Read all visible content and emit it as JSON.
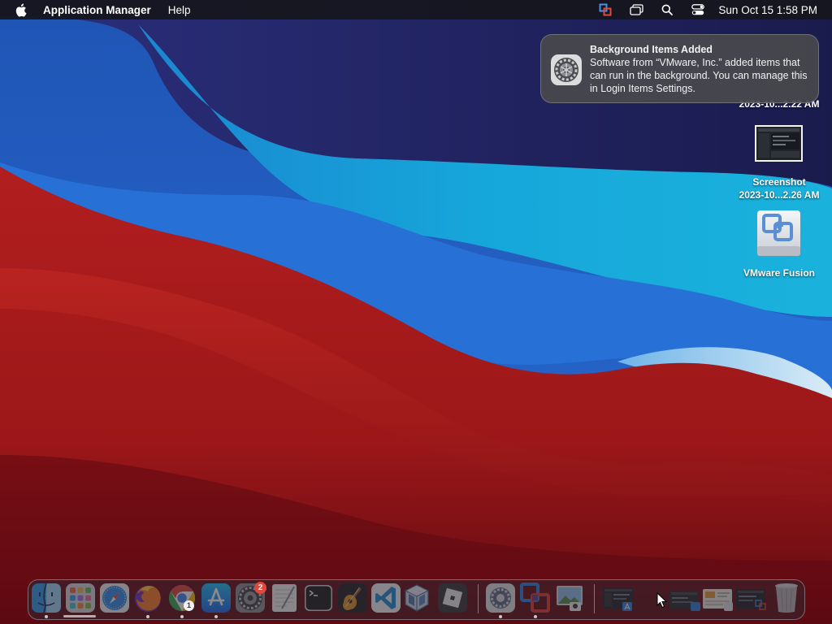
{
  "menubar": {
    "apple_icon": "apple-logo-icon",
    "app_name": "Application Manager",
    "menus": [
      "Help"
    ],
    "status_icons": [
      "vmware-fusion-icon",
      "screen-mirroring-icon",
      "spotlight-search-icon",
      "control-center-icon"
    ],
    "clock": "Sun Oct 15  1:58 PM"
  },
  "notification": {
    "icon": "system-settings-gear-icon",
    "title": "Background Items Added",
    "body": "Software from “VMware, Inc.” added items that can run in the background. You can manage this in Login Items Settings."
  },
  "desktop": {
    "items": [
      {
        "label": "2023-10...2.22 AM",
        "icon": "screenshot-thumbnail"
      },
      {
        "label_line1": "Screenshot",
        "label_line2": "2023-10...2.26 AM",
        "icon": "screenshot-thumbnail"
      },
      {
        "label": "VMware Fusion",
        "icon": "vmware-fusion-disk-icon"
      }
    ]
  },
  "dock": {
    "apps": [
      {
        "name": "Finder",
        "icon": "finder-icon",
        "running": true
      },
      {
        "name": "Launchpad",
        "icon": "launchpad-icon",
        "running": false
      },
      {
        "name": "Safari",
        "icon": "safari-icon",
        "running": false
      },
      {
        "name": "Firefox",
        "icon": "firefox-icon",
        "running": true
      },
      {
        "name": "Chrome",
        "icon": "chrome-icon",
        "running": true,
        "badge": "1"
      },
      {
        "name": "App Store",
        "icon": "app-store-icon",
        "running": true
      },
      {
        "name": "System Settings",
        "icon": "system-settings-icon",
        "running": false,
        "badge": "2"
      },
      {
        "name": "TextEdit",
        "icon": "textedit-icon",
        "running": false
      },
      {
        "name": "Terminal",
        "icon": "terminal-icon",
        "running": false
      },
      {
        "name": "GarageBand",
        "icon": "garageband-icon",
        "running": false
      },
      {
        "name": "Visual Studio Code",
        "icon": "vscode-icon",
        "running": false
      },
      {
        "name": "VirtualBox",
        "icon": "virtualbox-icon",
        "running": false
      },
      {
        "name": "Roblox",
        "icon": "roblox-icon",
        "running": false
      },
      {
        "name": "Application Manager",
        "icon": "application-manager-icon",
        "running": true
      },
      {
        "name": "VMware Fusion",
        "icon": "vmware-fusion-icon",
        "running": true
      },
      {
        "name": "Preview",
        "icon": "preview-icon",
        "running": false
      },
      {
        "name": "Recent Screenshot",
        "icon": "recent-window-icon",
        "running": false
      },
      {
        "name": "Downloads Stack",
        "icon": "downloads-stack-icon",
        "running": false
      },
      {
        "name": "Documents Stack",
        "icon": "documents-stack-icon",
        "running": false
      },
      {
        "name": "Screenshots Stack",
        "icon": "screenshots-stack-icon",
        "running": false
      },
      {
        "name": "Trash",
        "icon": "trash-icon",
        "running": false
      }
    ]
  },
  "colors": {
    "menubar_bg": "#16161c",
    "wallpaper_navy": "#1e1f5c",
    "wallpaper_cyan": "#19a9d8",
    "wallpaper_blue": "#2362c4",
    "wallpaper_red": "#a51a1c",
    "badge_red": "#e5453b"
  }
}
